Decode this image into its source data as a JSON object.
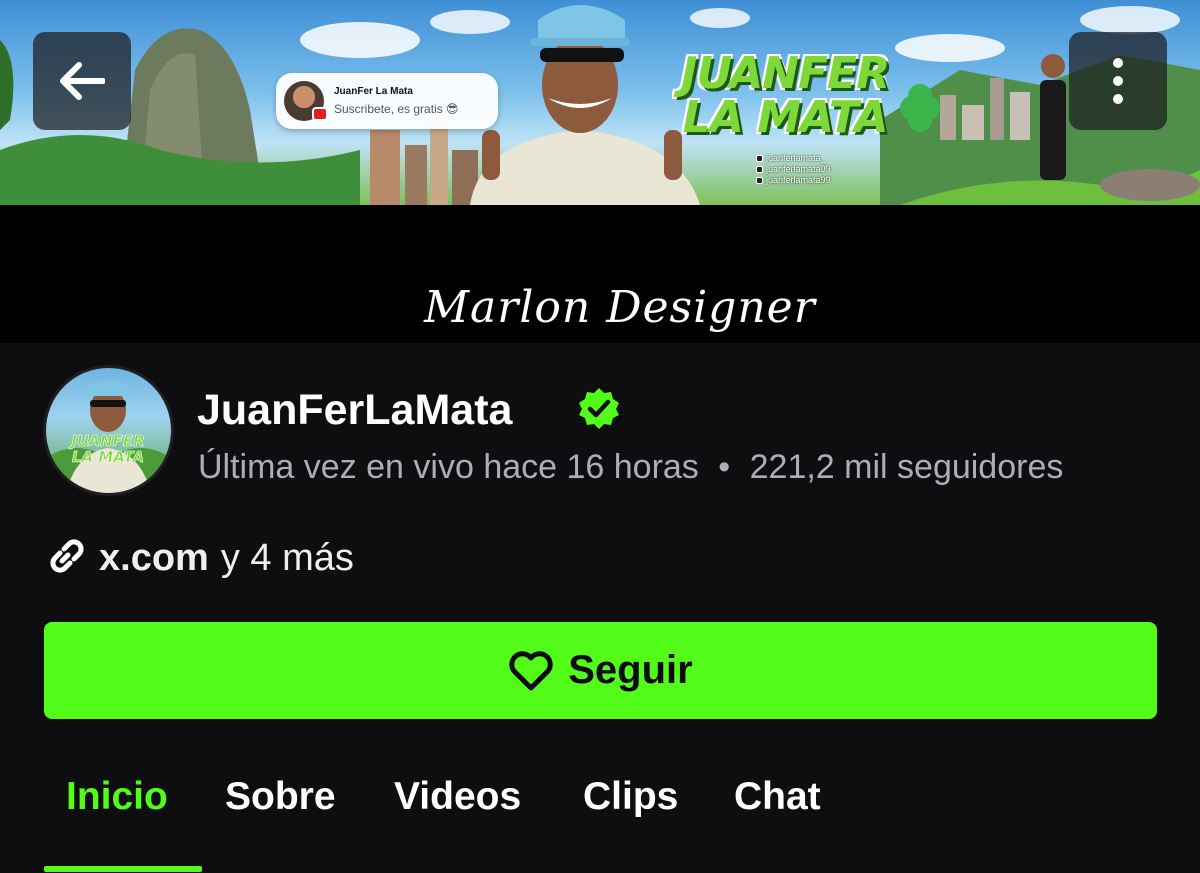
{
  "banner": {
    "subscribe_card": {
      "name": "JuanFer La Mata",
      "text": "Suscribete, es gratis 😎"
    },
    "title_line1": "JUANFER",
    "title_line2": "LA MATA",
    "handles": [
      "juanferlamata_",
      "juanferlamata09",
      "juanferlamata99"
    ]
  },
  "icons": {
    "back": "arrow-left-icon",
    "more": "more-vertical-icon",
    "verified": "verified-badge-icon",
    "link": "link-icon",
    "heart": "heart-icon"
  },
  "signature": "Marlon Designer",
  "profile": {
    "name": "JuanFerLaMata",
    "last_live": "Última vez en vivo hace 16 horas",
    "separator": "•",
    "followers": "221,2 mil seguidores",
    "link_domain": "x.com",
    "link_more": "y 4 más"
  },
  "follow_button": {
    "label": "Seguir"
  },
  "tabs": [
    {
      "label": "Inicio",
      "active": true
    },
    {
      "label": "Sobre",
      "active": false
    },
    {
      "label": "Videos",
      "active": false
    },
    {
      "label": "Clips",
      "active": false
    },
    {
      "label": "Chat",
      "active": false
    }
  ],
  "colors": {
    "accent": "#53fc18",
    "background": "#0e0e10",
    "muted_text": "#adadb8"
  }
}
